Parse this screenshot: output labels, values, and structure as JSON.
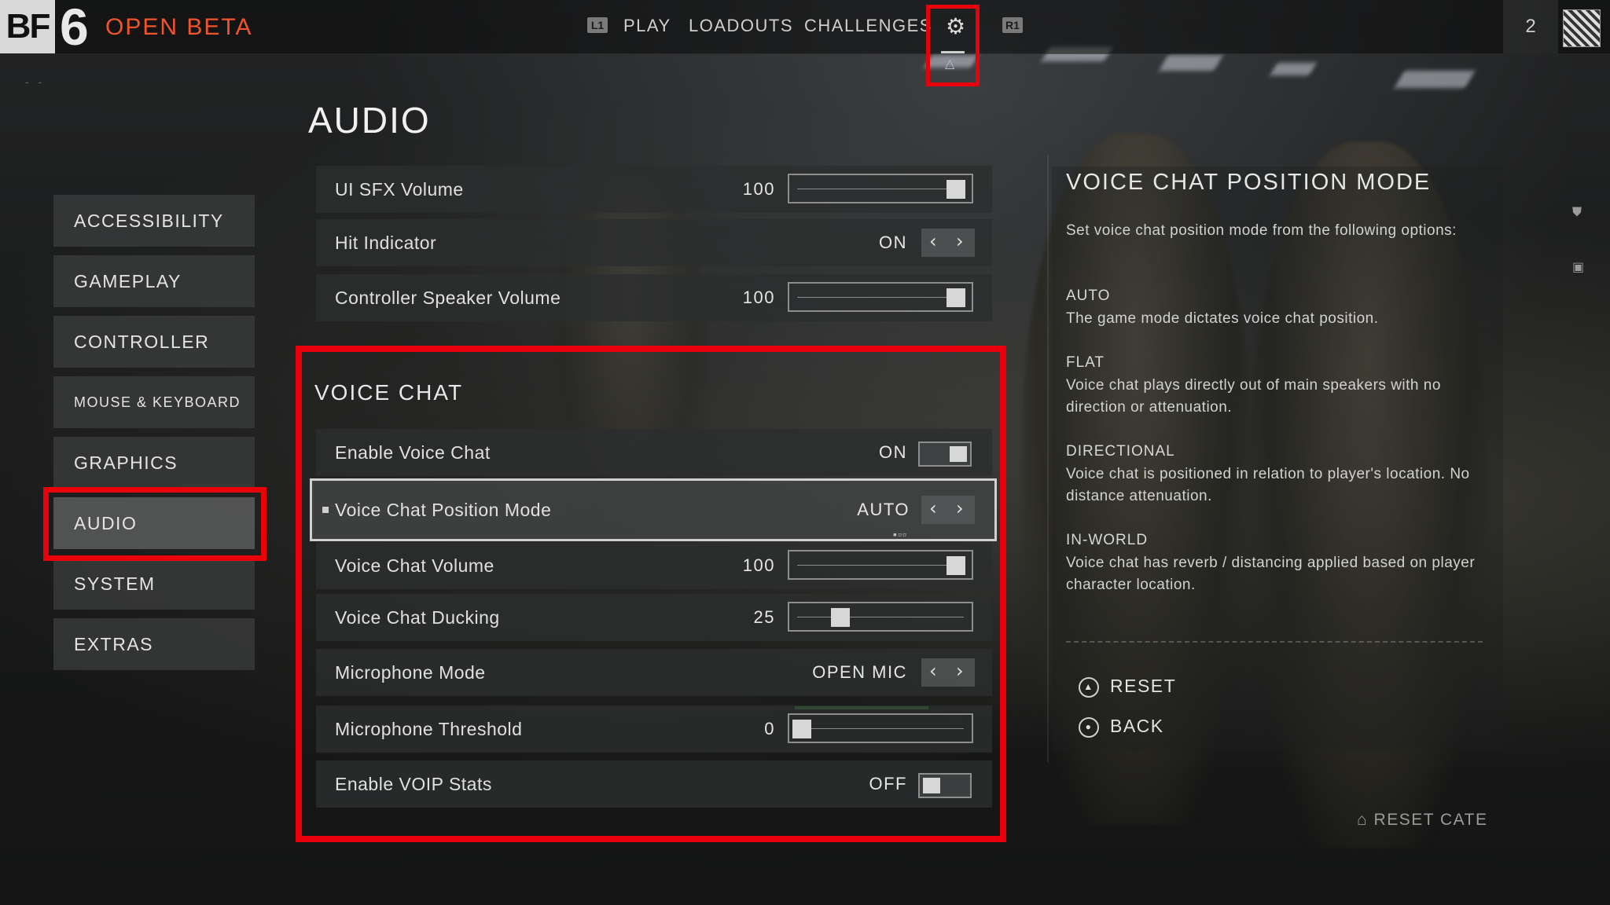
{
  "header": {
    "logo_bf": "BF",
    "logo_six": "6",
    "beta_label": "OPEN BETA",
    "nav": {
      "l1_glyph": "L1",
      "play": "PLAY",
      "loadouts": "LOADOUTS",
      "challenges": "CHALLENGES",
      "r1_glyph": "R1"
    },
    "player_count": "2"
  },
  "page": {
    "title": "AUDIO"
  },
  "sidebar": {
    "items": [
      {
        "label": "ACCESSIBILITY"
      },
      {
        "label": "GAMEPLAY"
      },
      {
        "label": "CONTROLLER"
      },
      {
        "label": "MOUSE & KEYBOARD"
      },
      {
        "label": "GRAPHICS"
      },
      {
        "label": "AUDIO",
        "active": true
      },
      {
        "label": "SYSTEM"
      },
      {
        "label": "EXTRAS"
      }
    ]
  },
  "audio_settings": [
    {
      "label": "UI SFX Volume",
      "value": "100",
      "type": "slider",
      "level": 1.0
    },
    {
      "label": "Hit Indicator",
      "value": "ON",
      "type": "selector"
    },
    {
      "label": "Controller Speaker Volume",
      "value": "100",
      "type": "slider",
      "level": 1.0
    }
  ],
  "voice_chat": {
    "title": "VOICE CHAT",
    "rows": [
      {
        "label": "Enable Voice Chat",
        "value": "ON",
        "type": "toggle",
        "on": true
      },
      {
        "label": "Voice Chat Position Mode",
        "value": "AUTO",
        "type": "selector",
        "focused": true
      },
      {
        "label": "Voice Chat Volume",
        "value": "100",
        "type": "slider",
        "level": 1.0
      },
      {
        "label": "Voice Chat Ducking",
        "value": "25",
        "type": "slider",
        "level": 0.25
      },
      {
        "label": "Microphone Mode",
        "value": "OPEN MIC",
        "type": "selector"
      },
      {
        "label": "Microphone Threshold",
        "value": "0",
        "type": "slider",
        "level": 0.0
      },
      {
        "label": "Enable VOIP Stats",
        "value": "OFF",
        "type": "toggle",
        "on": false
      }
    ]
  },
  "info_panel": {
    "title": "VOICE CHAT POSITION MODE",
    "intro": "Set voice chat position mode from the following options:",
    "options": [
      {
        "name": "AUTO",
        "desc": "The game mode dictates voice chat position."
      },
      {
        "name": "FLAT",
        "desc": "Voice chat plays directly out of main speakers with no direction or attenuation."
      },
      {
        "name": "DIRECTIONAL",
        "desc": "Voice chat is positioned in relation to player's location. No distance attenuation."
      },
      {
        "name": "IN-WORLD",
        "desc": "Voice chat has reverb / distancing applied based on player character location."
      }
    ],
    "actions": {
      "reset": "RESET",
      "back": "BACK"
    }
  },
  "footer": {
    "reset_category": "RESET CATE"
  },
  "colors": {
    "highlight_red": "#e8000b",
    "beta_orange": "#f0542c",
    "mic_level_green": "#3fbb4b"
  },
  "icons": {
    "settings": "gear-icon",
    "reset": "triangle-button-icon",
    "back": "circle-button-icon"
  }
}
